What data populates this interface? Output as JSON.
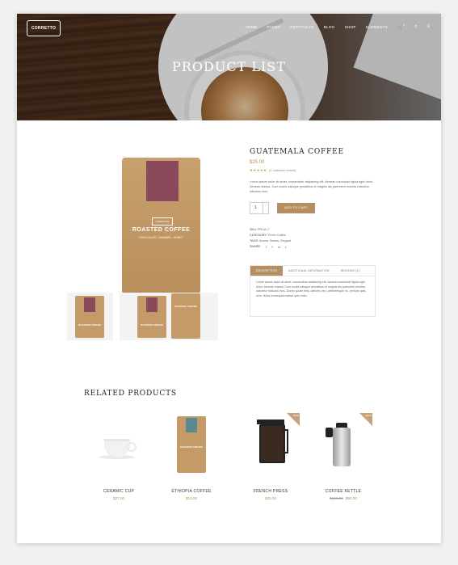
{
  "header": {
    "logo": "CORRETTO",
    "nav": [
      "HOME",
      "PAGES",
      "PORTFOLIO",
      "BLOG",
      "SHOP",
      "ELEMENTS"
    ],
    "cart_count": "0",
    "hero_title": "PRODUCT LIST"
  },
  "product": {
    "title": "GUATEMALA COFFEE",
    "price": "$25.00",
    "stars": "★★★★★",
    "reviews": "(1 customer review)",
    "description": "Lorem ipsum dolor sit amet, consectetur adipiscing elit. Aenean commodo ligula eget dolor. Aenean massa. Cum sociis natoque penatibus et magnis dis parturient montes nascetur ridiculus mus.",
    "quantity": "1",
    "add_to_cart": "ADD TO CART",
    "sku_label": "SKU:",
    "sku": "PR111-7",
    "category_label": "CATEGORY:",
    "category": "Fresh Coffee",
    "tags_label": "TAGS:",
    "tags": "Aroma, Beans, Elegant",
    "share_label": "SHARE:",
    "share_icons": [
      "facebook-icon",
      "twitter-icon",
      "linkedin-icon",
      "tumblr-icon"
    ],
    "bag_brand": "CORRETTO",
    "bag_title": "ROASTED COFFEE",
    "bag_sub": "CHOCOLATE, CARAMEL, HONEY"
  },
  "tabs": {
    "items": [
      "DESCRIPTION",
      "ADDITIONAL INFORMATION",
      "REVIEWS (1)"
    ],
    "active": "DESCRIPTION",
    "content": "Lorem ipsum dolor sit amet, consectetur adipiscing elit. Aenean commodo ligula eget dolor. Aenean massa. Cum sociis natoque penatibus et magnis dis parturient montes, nascetur ridiculus mus. Donec quam felis, ultricies nec, pellentesque eu, pretium quis, sem. Nulla consequat massa quis enim."
  },
  "related": {
    "title": "RELATED PRODUCTS",
    "items": [
      {
        "name": "CERAMIC CUP",
        "price": "$37.00",
        "old_price": ""
      },
      {
        "name": "ETHIOPIA COFFEE",
        "price": "$15.00",
        "old_price": ""
      },
      {
        "name": "FRENCH PRESS",
        "price": "$25.00",
        "old_price": "",
        "badge": "NEW"
      },
      {
        "name": "COFFEE KETTLE",
        "price": "$90.00",
        "old_price": "$100.00",
        "badge": "SALE"
      }
    ]
  },
  "colors": {
    "accent": "#b58f62",
    "label": "#8b4a5c"
  }
}
